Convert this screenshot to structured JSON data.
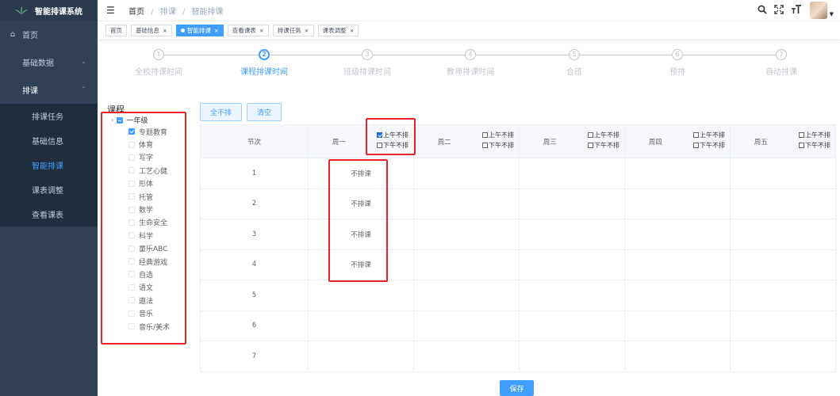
{
  "sidebar": {
    "brand": "智能排课系统",
    "home": "首页",
    "basic_data": "基础数据",
    "scheduling": "排课",
    "sub_items": [
      {
        "label": "排课任务"
      },
      {
        "label": "基础信息"
      },
      {
        "label": "智能排课"
      },
      {
        "label": "课表调整"
      },
      {
        "label": "查看课表"
      }
    ],
    "active_color": "#409eff"
  },
  "header": {
    "breadcrumb": [
      "首页",
      "排课",
      "智能排课"
    ],
    "separator": "/",
    "icons": [
      "search-icon",
      "fullscreen-icon",
      "font-size-icon"
    ]
  },
  "tags": [
    {
      "label": "首页",
      "closable": false
    },
    {
      "label": "基础信息",
      "closable": true
    },
    {
      "label": "智能排课",
      "closable": true,
      "active": true
    },
    {
      "label": "查看课表",
      "closable": true
    },
    {
      "label": "排课任务",
      "closable": true
    },
    {
      "label": "课表调整",
      "closable": true
    }
  ],
  "steps": [
    {
      "num": "1",
      "label": "全校排课时间"
    },
    {
      "num": "2",
      "label": "课程排课时间",
      "active": true
    },
    {
      "num": "3",
      "label": "班级排课时间"
    },
    {
      "num": "4",
      "label": "教师排课时间"
    },
    {
      "num": "5",
      "label": "合班"
    },
    {
      "num": "6",
      "label": "预排"
    },
    {
      "num": "7",
      "label": "自动排课"
    }
  ],
  "course_panel": {
    "title": "课程",
    "root": "一年级",
    "children": [
      {
        "label": "专题教育",
        "checked": true
      },
      {
        "label": "体育",
        "checked": false
      },
      {
        "label": "写字",
        "checked": false
      },
      {
        "label": "工艺心健",
        "checked": false
      },
      {
        "label": "形体",
        "checked": false
      },
      {
        "label": "托管",
        "checked": false
      },
      {
        "label": "数学",
        "checked": false
      },
      {
        "label": "生命安全",
        "checked": false
      },
      {
        "label": "科学",
        "checked": false
      },
      {
        "label": "童乐ABC",
        "checked": false
      },
      {
        "label": "经典游戏",
        "checked": false
      },
      {
        "label": "自选",
        "checked": false
      },
      {
        "label": "语文",
        "checked": false
      },
      {
        "label": "遨法",
        "checked": false
      },
      {
        "label": "音乐",
        "checked": false
      },
      {
        "label": "音乐/美术",
        "checked": false
      }
    ]
  },
  "buttons": {
    "none": "全不排",
    "clear": "清空",
    "save": "保存"
  },
  "table": {
    "period_header": "节次",
    "morning_option": "上午不排",
    "afternoon_option": "下午不排",
    "days": [
      {
        "name": "周一",
        "am_checked": true,
        "pm_checked": false
      },
      {
        "name": "周二",
        "am_checked": false,
        "pm_checked": false
      },
      {
        "name": "周三",
        "am_checked": false,
        "pm_checked": false
      },
      {
        "name": "周四",
        "am_checked": false,
        "pm_checked": false
      },
      {
        "name": "周五",
        "am_checked": false,
        "pm_checked": false
      }
    ],
    "rows": [
      {
        "period": "1",
        "cells": [
          "不排课",
          "",
          "",
          "",
          ""
        ]
      },
      {
        "period": "2",
        "cells": [
          "不排课",
          "",
          "",
          "",
          ""
        ]
      },
      {
        "period": "3",
        "cells": [
          "不排课",
          "",
          "",
          "",
          ""
        ]
      },
      {
        "period": "4",
        "cells": [
          "不排课",
          "",
          "",
          "",
          ""
        ]
      },
      {
        "period": "5",
        "cells": [
          "",
          "",
          "",
          "",
          ""
        ]
      },
      {
        "period": "6",
        "cells": [
          "",
          "",
          "",
          "",
          ""
        ]
      },
      {
        "period": "7",
        "cells": [
          "",
          "",
          "",
          "",
          ""
        ]
      }
    ]
  },
  "annotation_color": "#e8242b"
}
